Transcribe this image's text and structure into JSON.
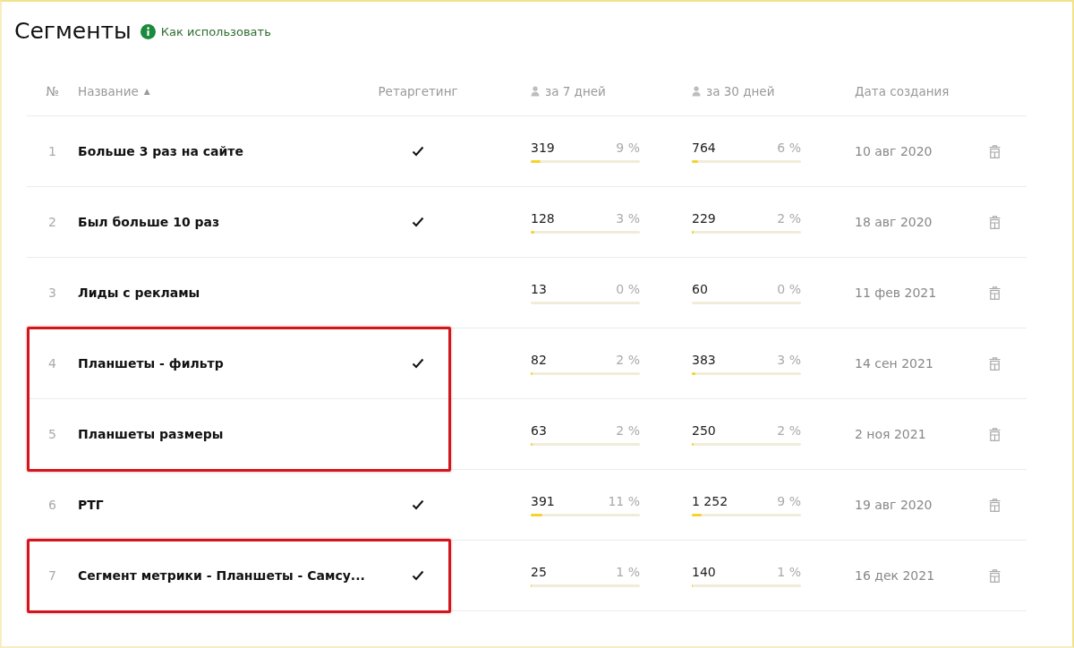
{
  "title": "Сегменты",
  "help_link": "Как использовать",
  "columns": {
    "number": "№",
    "name": "Название",
    "sort_indicator": "▲",
    "retargeting": "Ретаргетинг",
    "week": "за 7 дней",
    "month": "за 30 дней",
    "created": "Дата создания"
  },
  "rows": [
    {
      "number": "1",
      "name": "Больше 3 раз на сайте",
      "retargeting": true,
      "week": {
        "value": "319",
        "percent": "9 %",
        "level": 0.09
      },
      "month": {
        "value": "764",
        "percent": "6 %",
        "level": 0.06
      },
      "created": "10 авг 2020",
      "highlighted": false
    },
    {
      "number": "2",
      "name": "Был больше 10 раз",
      "retargeting": true,
      "week": {
        "value": "128",
        "percent": "3 %",
        "level": 0.03
      },
      "month": {
        "value": "229",
        "percent": "2 %",
        "level": 0.02
      },
      "created": "18 авг 2020",
      "highlighted": false
    },
    {
      "number": "3",
      "name": "Лиды с рекламы",
      "retargeting": false,
      "week": {
        "value": "13",
        "percent": "0 %",
        "level": 0
      },
      "month": {
        "value": "60",
        "percent": "0 %",
        "level": 0
      },
      "created": "11 фев 2021",
      "highlighted": false
    },
    {
      "number": "4",
      "name": "Планшеты - фильтр",
      "retargeting": true,
      "week": {
        "value": "82",
        "percent": "2 %",
        "level": 0.02
      },
      "month": {
        "value": "383",
        "percent": "3 %",
        "level": 0.03
      },
      "created": "14 сен 2021",
      "highlighted": true
    },
    {
      "number": "5",
      "name": "Планшеты размеры",
      "retargeting": false,
      "week": {
        "value": "63",
        "percent": "2 %",
        "level": 0.02
      },
      "month": {
        "value": "250",
        "percent": "2 %",
        "level": 0.02
      },
      "created": "2 ноя 2021",
      "highlighted": true
    },
    {
      "number": "6",
      "name": "РТГ",
      "retargeting": true,
      "week": {
        "value": "391",
        "percent": "11 %",
        "level": 0.11
      },
      "month": {
        "value": "1 252",
        "percent": "9 %",
        "level": 0.09
      },
      "created": "19 авг 2020",
      "highlighted": false
    },
    {
      "number": "7",
      "name": "Сегмент метрики - Планшеты - Самсу...",
      "retargeting": true,
      "week": {
        "value": "25",
        "percent": "1 %",
        "level": 0.01
      },
      "month": {
        "value": "140",
        "percent": "1 %",
        "level": 0.01
      },
      "created": "16 дек 2021",
      "highlighted": true
    }
  ]
}
